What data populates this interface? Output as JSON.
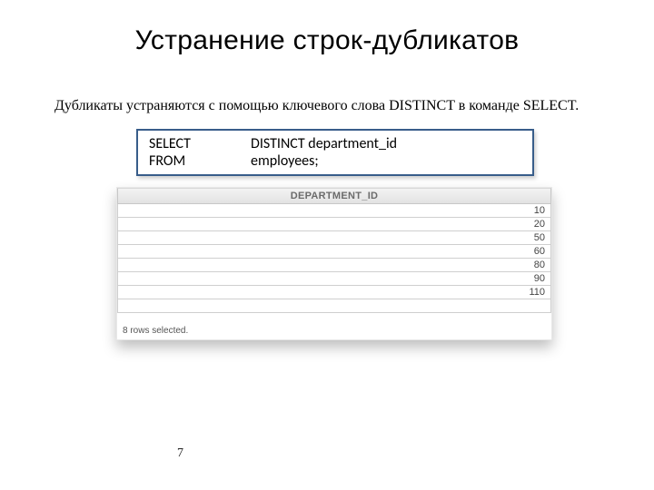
{
  "title": "Устранение строк-дубликатов",
  "description": "Дубликаты устраняются с помощью ключевого слова DISTINCT в команде SELECT.",
  "code": {
    "line1_kw": "SELECT",
    "line1_rest": "DISTINCT department_id",
    "line2_kw": "FROM",
    "line2_rest": "employees;"
  },
  "result": {
    "header": "DEPARTMENT_ID",
    "rows": [
      "10",
      "20",
      "50",
      "60",
      "80",
      "90",
      "110",
      ""
    ],
    "status": "8 rows selected."
  },
  "page_number": "7"
}
